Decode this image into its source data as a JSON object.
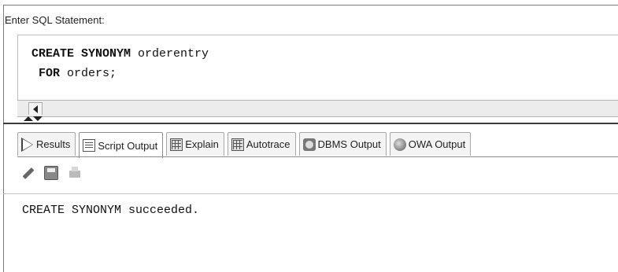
{
  "editor": {
    "label": "Enter SQL Statement:",
    "lines": [
      {
        "keyword": "CREATE SYNONYM",
        "rest": " orderentry"
      },
      {
        "keyword": " FOR",
        "rest": " orders;"
      }
    ]
  },
  "tabs": [
    {
      "label": "Results",
      "icon": "play-icon",
      "active": false
    },
    {
      "label": "Script Output",
      "icon": "document-icon",
      "active": true
    },
    {
      "label": "Explain",
      "icon": "explain-grid-icon",
      "active": false
    },
    {
      "label": "Autotrace",
      "icon": "autotrace-grid-icon",
      "active": false
    },
    {
      "label": "DBMS Output",
      "icon": "dbms-icon",
      "active": false
    },
    {
      "label": "OWA Output",
      "icon": "globe-icon",
      "active": false
    }
  ],
  "toolbar": {
    "icons": [
      "pencil-clear-icon",
      "save-disk-icon",
      "print-icon"
    ]
  },
  "output": {
    "text": "CREATE SYNONYM succeeded."
  }
}
